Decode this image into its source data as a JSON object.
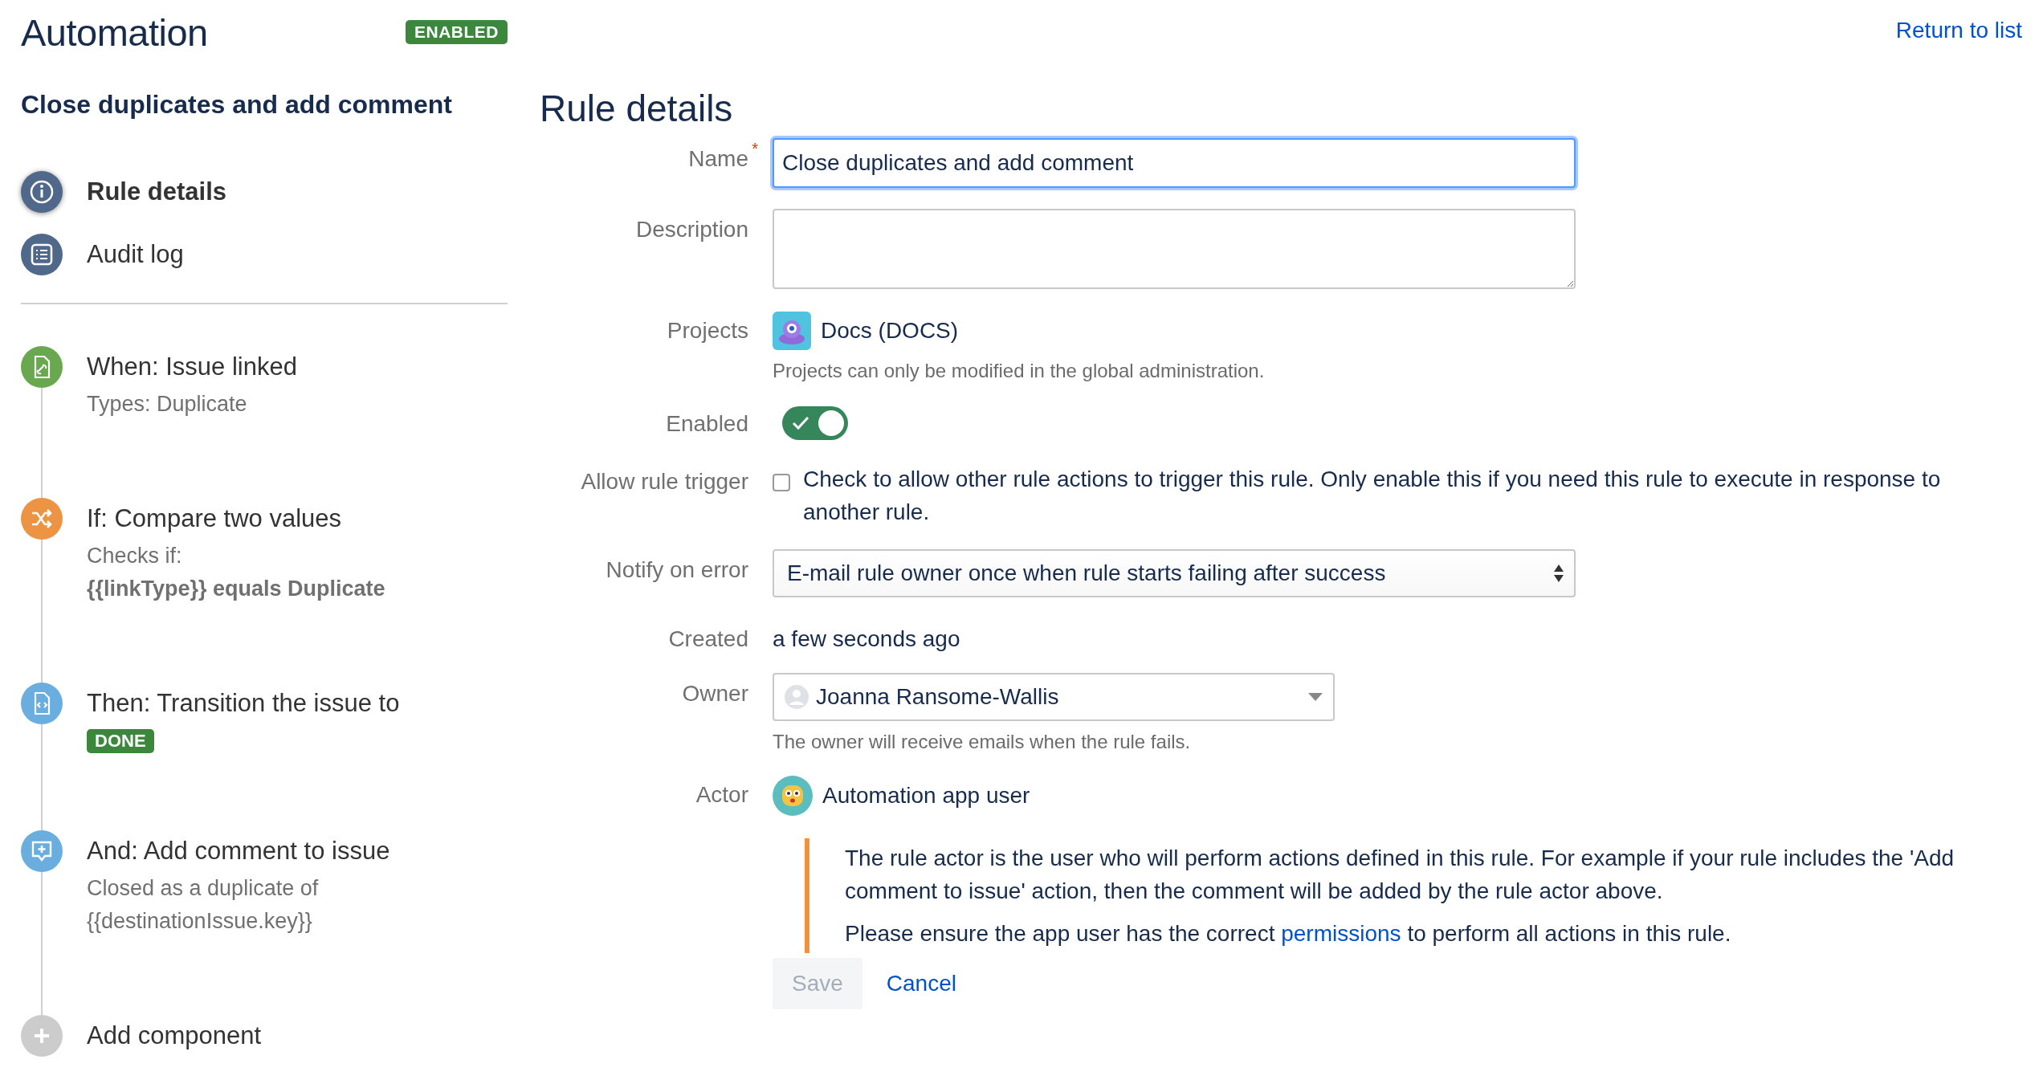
{
  "header": {
    "title": "Automation",
    "status_badge": "ENABLED",
    "return_link": "Return to list"
  },
  "sidebar": {
    "rule_name": "Close duplicates and add comment",
    "nav": [
      {
        "label": "Rule details",
        "selected": true,
        "kind": "info"
      },
      {
        "label": "Audit log",
        "selected": false,
        "kind": "list"
      }
    ],
    "components": [
      {
        "kind": "trigger",
        "title": "When: Issue linked",
        "lines": [
          {
            "text": "Types: Duplicate",
            "bold": false
          }
        ]
      },
      {
        "kind": "condition",
        "title": "If: Compare two values",
        "lines": [
          {
            "text": "Checks if:",
            "bold": false
          },
          {
            "text": "{{linkType}} equals Duplicate",
            "bold": true
          }
        ]
      },
      {
        "kind": "transition",
        "title": "Then: Transition the issue to",
        "badge": "DONE"
      },
      {
        "kind": "comment",
        "title": "And: Add comment to issue",
        "lines": [
          {
            "text": "Closed as a duplicate of",
            "bold": false
          },
          {
            "text": "{{destinationIssue.key}}",
            "bold": false
          }
        ]
      },
      {
        "kind": "add",
        "title": "Add component"
      }
    ]
  },
  "form": {
    "heading": "Rule details",
    "fields": [
      {
        "kind": "text",
        "label": "Name",
        "required_marker": "*",
        "focused": true,
        "value": "Close duplicates and add comment"
      },
      {
        "kind": "textarea",
        "label": "Description"
      },
      {
        "kind": "project",
        "label": "Projects",
        "value": "Docs (DOCS)",
        "hint": "Projects can only be modified in the global administration."
      },
      {
        "kind": "toggle",
        "label": "Enabled",
        "on": true
      },
      {
        "kind": "checkbox",
        "label": "Allow rule trigger",
        "checked": false,
        "text": "Check to allow other rule actions to trigger this rule. Only enable this if you need this rule to execute in response to another rule."
      },
      {
        "kind": "select",
        "label": "Notify on error",
        "value": "E-mail rule owner once when rule starts failing after success"
      },
      {
        "kind": "static",
        "label": "Created",
        "value": "a few seconds ago"
      },
      {
        "kind": "user_select",
        "label": "Owner",
        "value": "Joanna Ransome-Wallis",
        "hint": "The owner will receive emails when the rule fails."
      },
      {
        "kind": "actor",
        "label": "Actor",
        "value": "Automation app user",
        "note": {
          "text": "The rule actor is the user who will perform actions defined in this rule. For example if your rule includes the 'Add comment to issue' action, then the comment will be added by the rule actor above.",
          "before": "Please ensure the app user has the correct ",
          "link": "permissions",
          "after": " to perform all actions in this rule."
        }
      }
    ],
    "buttons": [
      {
        "label": "Save",
        "kind": "primary",
        "disabled": true
      },
      {
        "label": "Cancel",
        "kind": "link"
      }
    ]
  }
}
